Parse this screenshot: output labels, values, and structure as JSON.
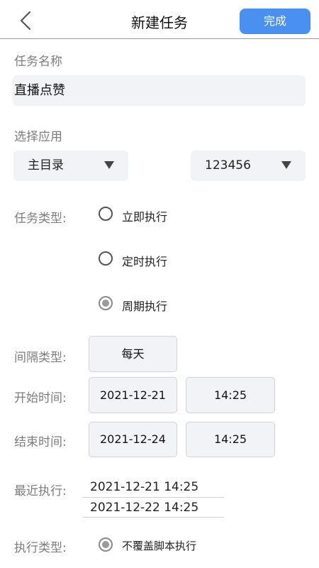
{
  "header": {
    "title": "新建任务",
    "done_label": "完成"
  },
  "task_name": {
    "label": "任务名称",
    "value": "直播点赞"
  },
  "app_select": {
    "label": "选择应用",
    "directory": "主目录",
    "app": "123456"
  },
  "task_type": {
    "label": "任务类型:",
    "options": [
      {
        "label": "立即执行",
        "selected": false
      },
      {
        "label": "定时执行",
        "selected": false
      },
      {
        "label": "周期执行",
        "selected": true
      }
    ]
  },
  "interval": {
    "label": "间隔类型:",
    "value": "每天"
  },
  "start_time": {
    "label": "开始时间:",
    "date": "2021-12-21",
    "time": "14:25"
  },
  "end_time": {
    "label": "结束时间:",
    "date": "2021-12-24",
    "time": "14:25"
  },
  "recent": {
    "label": "最近执行:",
    "items": [
      "2021-12-21 14:25",
      "2021-12-22 14:25"
    ]
  },
  "exec_type": {
    "label": "执行类型:",
    "option": "不覆盖脚本执行",
    "selected": true
  }
}
